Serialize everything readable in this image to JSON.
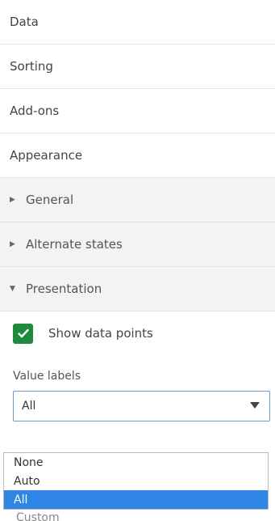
{
  "sections": [
    {
      "label": "Data"
    },
    {
      "label": "Sorting"
    },
    {
      "label": "Add-ons"
    },
    {
      "label": "Appearance"
    }
  ],
  "appearance_groups": [
    {
      "label": "General",
      "expanded": false
    },
    {
      "label": "Alternate states",
      "expanded": false
    },
    {
      "label": "Presentation",
      "expanded": true
    }
  ],
  "presentation": {
    "show_data_points": {
      "label": "Show data points",
      "checked": true
    },
    "value_labels": {
      "label": "Value labels",
      "selected": "All",
      "options": [
        "None",
        "Auto",
        "All"
      ]
    },
    "below_dropdown_text": "Custom"
  },
  "colors": {
    "checkbox": "#1f8a3b",
    "selected_option": "#2f86e6",
    "select_border": "#6f9ccd"
  }
}
